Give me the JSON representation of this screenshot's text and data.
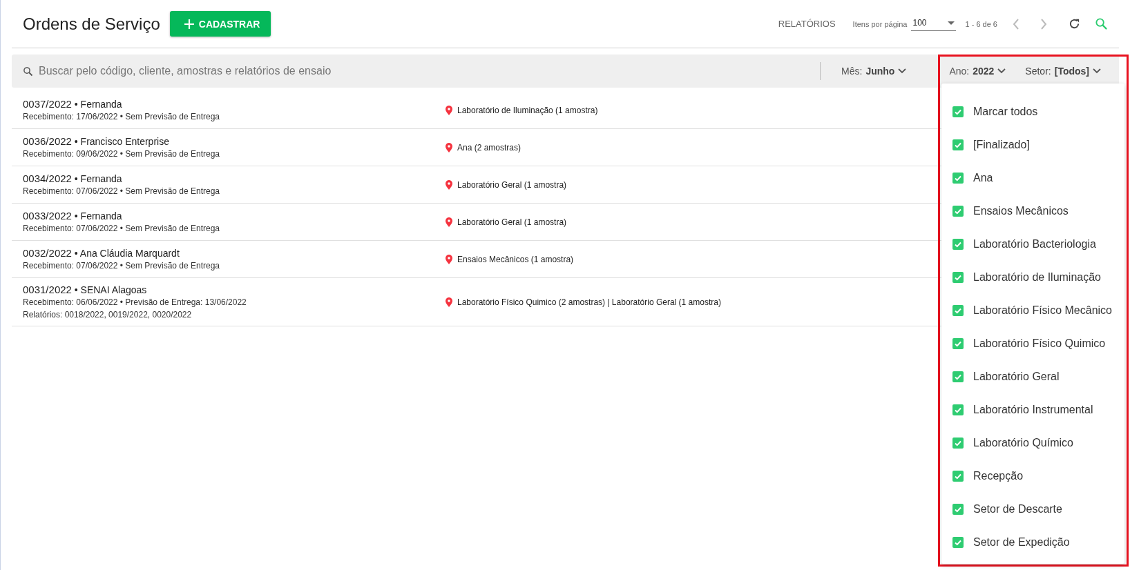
{
  "header": {
    "title": "Ordens de Serviço",
    "add_button": "CADASTRAR",
    "reports_link": "RELATÓRIOS",
    "page_size_label": "Itens por página",
    "page_size": "100",
    "range": "1 - 6 de 6",
    "prev_disabled": true,
    "next_disabled": true
  },
  "search": {
    "placeholder": "Buscar pelo código, cliente, amostras e relatórios de ensaio"
  },
  "filters": [
    {
      "label": "Mês:",
      "value": "Junho",
      "expanded": false
    },
    {
      "label": "Ano:",
      "value": "2022",
      "expanded": false
    },
    {
      "label": "Setor:",
      "value": "[Todos]",
      "expanded": true
    }
  ],
  "order_separator": "•",
  "orders": [
    {
      "code": "0037/2022",
      "client": "Fernanda",
      "dates": "Recebimento: 17/06/2022 • Sem Previsão de Entrega",
      "location": "Laboratório de Iluminação (1 amostra)"
    },
    {
      "code": "0036/2022",
      "client": "Francisco Enterprise",
      "dates": "Recebimento: 09/06/2022 • Sem Previsão de Entrega",
      "location": "Ana (2 amostras)"
    },
    {
      "code": "0034/2022",
      "client": "Fernanda",
      "dates": "Recebimento: 07/06/2022 • Sem Previsão de Entrega",
      "location": "Laboratório Geral (1 amostra)"
    },
    {
      "code": "0033/2022",
      "client": "Fernanda",
      "dates": "Recebimento: 07/06/2022 • Sem Previsão de Entrega",
      "location": "Laboratório Geral (1 amostra)"
    },
    {
      "code": "0032/2022",
      "client": "Ana Cláudia Marquardt",
      "dates": "Recebimento: 07/06/2022 • Sem Previsão de Entrega",
      "location": "Ensaios Mecânicos (1 amostra)"
    },
    {
      "code": "0031/2022",
      "client": "SENAI Alagoas",
      "dates": "Recebimento: 06/06/2022 • Previsão de Entrega: 13/06/2022",
      "reports": "Relatórios: 0018/2022, 0019/2022, 0020/2022",
      "location": "Laboratório Físico Quimico (2 amostras) | Laboratório Geral (1 amostra)"
    }
  ],
  "sector_dropdown": {
    "highlighted": true,
    "options": [
      {
        "label": "Marcar todos",
        "checked": true
      },
      {
        "label": "[Finalizado]",
        "checked": true
      },
      {
        "label": "Ana",
        "checked": true
      },
      {
        "label": "Ensaios Mecânicos",
        "checked": true
      },
      {
        "label": "Laboratório Bacteriologia",
        "checked": true
      },
      {
        "label": "Laboratório de Iluminação",
        "checked": true
      },
      {
        "label": "Laboratório Físico Mecânico",
        "checked": true
      },
      {
        "label": "Laboratório Físico Quimico",
        "checked": true
      },
      {
        "label": "Laboratório Geral",
        "checked": true
      },
      {
        "label": "Laboratório Instrumental",
        "checked": true
      },
      {
        "label": "Laboratório Químico",
        "checked": true
      },
      {
        "label": "Recepção",
        "checked": true
      },
      {
        "label": "Setor de Descarte",
        "checked": true
      },
      {
        "label": "Setor de Expedição",
        "checked": true
      }
    ]
  }
}
